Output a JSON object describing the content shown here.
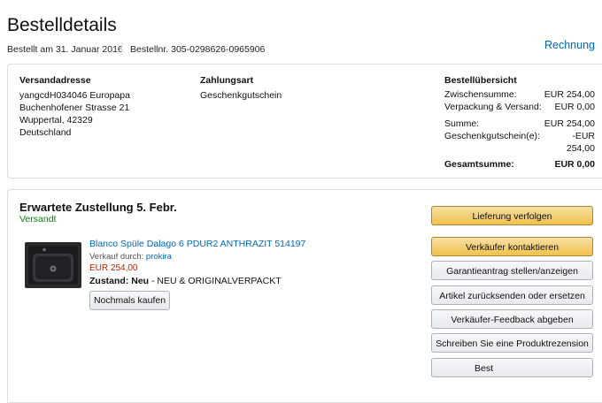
{
  "page_title": "Bestelldetails",
  "order_meta": {
    "ordered_on": "Bestellt am 31. Januar 2016",
    "order_number": "Bestellnr. 305-0298626-0965906"
  },
  "invoice_link": "Rechnung",
  "shipping": {
    "heading": "Versandadresse",
    "lines": [
      "yangcdH034046 Europapa",
      "Buchenhofener Strasse 21",
      "Wuppertal, 42329",
      "Deutschland"
    ]
  },
  "payment": {
    "heading": "Zahlungsart",
    "method": "Geschenkgutschein"
  },
  "summary": {
    "heading": "Bestellübersicht",
    "subtotal_label": "Zwischensumme:",
    "subtotal_value": "EUR 254,00",
    "shipping_label": "Verpackung & Versand:",
    "shipping_value": "EUR 0,00",
    "sum_label": "Summe:",
    "sum_value": "EUR 254,00",
    "gift_label": "Geschenkgutschein(e):",
    "gift_value_1": "-EUR",
    "gift_value_2": "254,00",
    "total_label": "Gesamtsumme:",
    "total_value": "EUR 0,00"
  },
  "shipment": {
    "delivery_heading": "Erwartete Zustellung 5. Febr.",
    "status": "Versandt",
    "product_title": "Blanco Spüle Dalago 6 PDUR2 ANTHRAZIT 514197",
    "seller_prefix": "Verkauf durch:",
    "seller_name": "prokira",
    "price": "EUR 254,00",
    "condition_label": "Zustand:",
    "condition_value": "Neu",
    "condition_note": "- NEU & ORIGINALVERPACKT",
    "buy_again": "Nochmals kaufen"
  },
  "actions": {
    "track": "Lieferung verfolgen",
    "contact_seller": "Verkäufer kontaktieren",
    "guarantee": "Garantieantrag stellen/anzeigen",
    "return": "Artikel zurücksenden oder ersetzen",
    "feedback": "Verkäufer-Feedback abgeben",
    "review": "Schreiben Sie eine Produktrezension",
    "partial": "Best"
  },
  "colors": {
    "link": "#0066c0",
    "status_green": "#008a00",
    "price_red": "#b12704",
    "button_yellow": "#f0c14b"
  }
}
